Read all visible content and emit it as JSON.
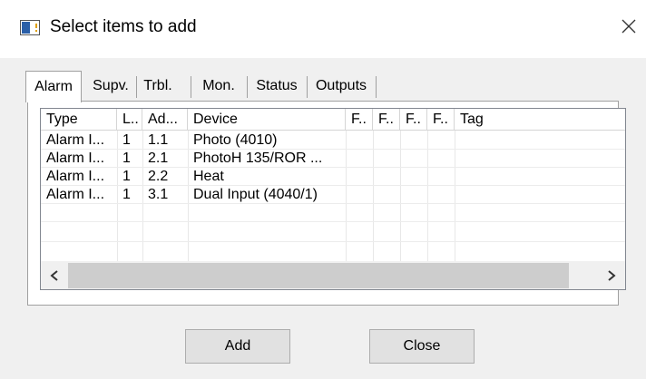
{
  "window": {
    "title": "Select items to add",
    "close_icon": "close-icon"
  },
  "tabs": [
    {
      "label": "Alarm",
      "active": true
    },
    {
      "label": "Supv.",
      "active": false
    },
    {
      "label": "Trbl.",
      "active": false
    },
    {
      "label": "Mon.",
      "active": false
    },
    {
      "label": "Status",
      "active": false
    },
    {
      "label": "Outputs",
      "active": false
    }
  ],
  "grid": {
    "columns": [
      "Type",
      "L..",
      "Ad...",
      "Device",
      "F..",
      "F..",
      "F..",
      "F..",
      "Tag"
    ],
    "rows": [
      [
        "Alarm I...",
        "1",
        "1.1",
        "Photo (4010)",
        "",
        "",
        "",
        "",
        ""
      ],
      [
        "Alarm I...",
        "1",
        "2.1",
        "PhotoH 135/ROR ...",
        "",
        "",
        "",
        "",
        ""
      ],
      [
        "Alarm I...",
        "1",
        "2.2",
        "Heat",
        "",
        "",
        "",
        "",
        ""
      ],
      [
        "Alarm I...",
        "1",
        "3.1",
        "Dual Input (4040/1)",
        "",
        "",
        "",
        "",
        ""
      ]
    ]
  },
  "buttons": {
    "add_label": "Add",
    "close_label": "Close"
  }
}
